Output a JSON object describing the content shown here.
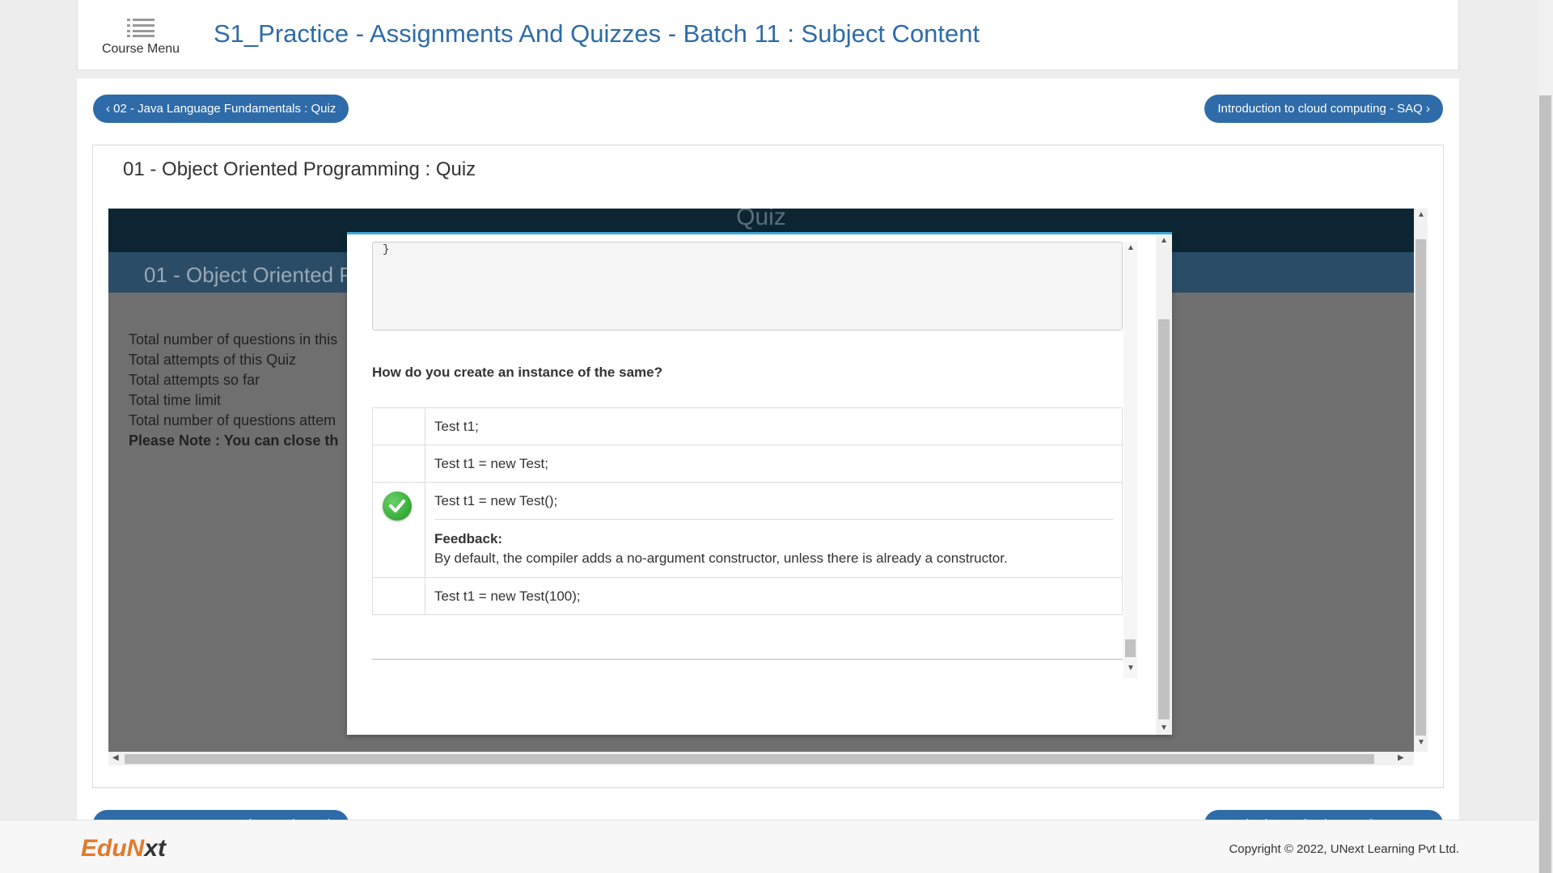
{
  "header": {
    "course_menu_label": "Course Menu",
    "title": "S1_Practice - Assignments And Quizzes - Batch 11 : Subject Content"
  },
  "nav": {
    "prev_label": "‹ 02 - Java Language Fundamentals : Quiz",
    "next_label": "Introduction to cloud computing - SAQ ›"
  },
  "content": {
    "title": "01 - Object Oriented Programming : Quiz"
  },
  "frame": {
    "quiz_heading": "Quiz",
    "band_title": "01 - Object Oriented P",
    "info_lines": [
      "Total number of questions in this",
      "Total attempts of this Quiz",
      "Total attempts so far",
      "Total time limit",
      "Total number of questions attem"
    ],
    "note": "Please Note : You can close th"
  },
  "modal": {
    "code_tail": "}",
    "question": "How do you create an instance of the same?",
    "options": [
      {
        "text": "Test t1;"
      },
      {
        "text": "Test t1 = new Test;"
      },
      {
        "text": "Test t1 = new Test();",
        "correct": true,
        "feedback_label": "Feedback:",
        "feedback": "By default, the compiler adds a no-argument constructor, unless there is already a constructor."
      },
      {
        "text": "Test t1 = new Test(100);"
      }
    ]
  },
  "footer": {
    "logo_part1": "EduN",
    "logo_part2": "xt",
    "copyright": "Copyright © 2022, UNext Learning Pvt Ltd."
  },
  "icons": {
    "menu": "hamburger-icon",
    "correct": "checkmark-circle-icon"
  },
  "colors": {
    "primary_blue": "#2e6ba8",
    "modal_accent": "#3fa7d6",
    "correct_green": "#2aa82a",
    "logo_orange": "#e07b2c"
  }
}
